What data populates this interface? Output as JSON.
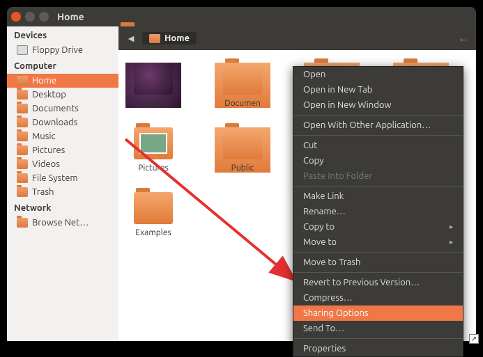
{
  "window": {
    "title": "Home"
  },
  "toolbar": {
    "path": "Home"
  },
  "sidebar": {
    "devices_hdr": "Devices",
    "devices": [
      {
        "label": "Floppy Drive"
      }
    ],
    "computer_hdr": "Computer",
    "computer": [
      {
        "label": "Home",
        "selected": true
      },
      {
        "label": "Desktop"
      },
      {
        "label": "Documents"
      },
      {
        "label": "Downloads"
      },
      {
        "label": "Music"
      },
      {
        "label": "Pictures"
      },
      {
        "label": "Videos"
      },
      {
        "label": "File System"
      },
      {
        "label": "Trash"
      }
    ],
    "network_hdr": "Network",
    "network": [
      {
        "label": "Browse Net…"
      }
    ]
  },
  "grid": [
    {
      "label": "Desktop",
      "kind": "desk"
    },
    {
      "label": "Documen",
      "kind": "fold"
    },
    {
      "label": "",
      "kind": "fold"
    },
    {
      "label": "",
      "kind": "fold"
    },
    {
      "label": "Pictures",
      "kind": "pic"
    },
    {
      "label": "Public",
      "kind": "fold"
    },
    {
      "label": "",
      "kind": "fold"
    },
    {
      "label": "",
      "kind": "fold"
    },
    {
      "label": "Examples",
      "kind": "ex"
    }
  ],
  "context_menu": [
    {
      "label": "Open"
    },
    {
      "label": "Open in New Tab"
    },
    {
      "label": "Open in New Window"
    },
    {
      "sep": true
    },
    {
      "label": "Open With Other Application…"
    },
    {
      "sep": true
    },
    {
      "label": "Cut"
    },
    {
      "label": "Copy"
    },
    {
      "label": "Paste Into Folder",
      "disabled": true
    },
    {
      "sep": true
    },
    {
      "label": "Make Link"
    },
    {
      "label": "Rename…"
    },
    {
      "label": "Copy to",
      "submenu": true
    },
    {
      "label": "Move to",
      "submenu": true
    },
    {
      "sep": true
    },
    {
      "label": "Move to Trash"
    },
    {
      "sep": true
    },
    {
      "label": "Revert to Previous Version…"
    },
    {
      "label": "Compress…"
    },
    {
      "label": "Sharing Options",
      "highlighted": true
    },
    {
      "label": "Send To…"
    },
    {
      "sep": true
    },
    {
      "label": "Properties"
    }
  ]
}
